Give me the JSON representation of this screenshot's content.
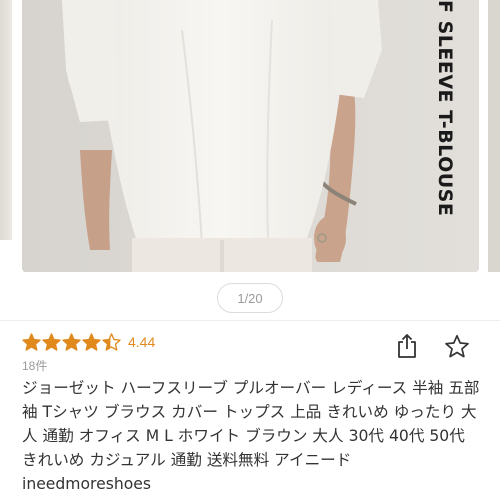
{
  "gallery": {
    "caption": "F SLEEVE T-BLOUSE",
    "pager": "1/20"
  },
  "rating": {
    "value": "4.44",
    "stars": 4.44,
    "review_count": "18件",
    "star_color": "#e08a1e"
  },
  "actions": {
    "share_icon": "share-icon",
    "favorite_icon": "star-outline-icon"
  },
  "product": {
    "title": "ジョーゼット ハーフスリーブ プルオーバー レディース 半袖 五部袖 Tシャツ ブラウス カバー トップス 上品 きれいめ ゆったり 大人 通勤 オフィス M L ホワイト ブラウン 大人 30代 40代 50代 きれいめ カジュアル 通勤 送料無料 アイニード ineedmoreshoes"
  }
}
